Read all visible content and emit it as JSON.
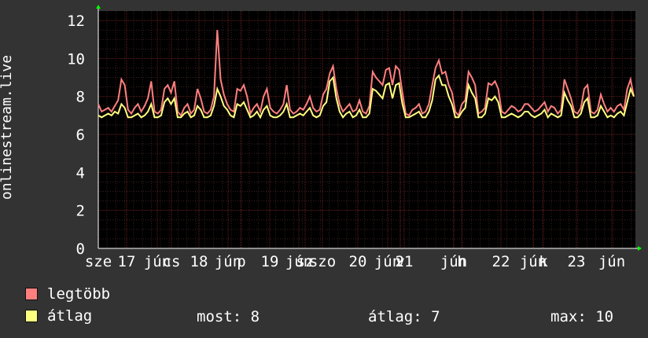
{
  "chart_data": {
    "type": "line",
    "ylabel": "onlinestream.live",
    "ylim": [
      0,
      12.5
    ],
    "yticks": [
      0,
      2,
      4,
      6,
      8,
      10,
      12
    ],
    "grid": true,
    "xtick_labels": [
      "sze",
      "17",
      "jún",
      "cs",
      "18",
      "jún",
      "p",
      "19",
      "jún",
      "sz",
      "szo",
      "20",
      "jún",
      "v",
      "21",
      "jún",
      "h",
      "22",
      "jún",
      "k",
      "23",
      "jún"
    ],
    "series": [
      {
        "name": "legtöbb",
        "color": "#ff7f7f",
        "values": [
          7.6,
          7.2,
          7.3,
          7.4,
          7.2,
          7.5,
          7.8,
          8.9,
          8.6,
          7.3,
          7.1,
          7.4,
          7.6,
          7.2,
          7.5,
          7.9,
          8.8,
          7.2,
          7.1,
          7.3,
          8.4,
          8.6,
          8.2,
          8.8,
          7.2,
          7.0,
          7.4,
          7.6,
          7.1,
          7.3,
          8.4,
          7.9,
          7.2,
          7.1,
          7.3,
          8.0,
          11.5,
          8.9,
          8.1,
          7.6,
          7.3,
          7.2,
          8.4,
          8.3,
          8.6,
          8.0,
          7.1,
          7.4,
          7.6,
          7.2,
          8.0,
          8.4,
          7.4,
          7.2,
          7.1,
          7.3,
          7.6,
          8.6,
          7.3,
          7.1,
          7.2,
          7.4,
          7.3,
          7.6,
          8.0,
          7.4,
          7.2,
          7.3,
          8.1,
          8.4,
          9.2,
          9.6,
          8.4,
          7.6,
          7.2,
          7.4,
          7.6,
          7.2,
          7.3,
          7.8,
          7.2,
          7.1,
          7.5,
          9.3,
          9.0,
          8.8,
          8.6,
          9.4,
          9.5,
          8.6,
          9.6,
          9.4,
          8.2,
          7.1,
          7.0,
          7.3,
          7.4,
          7.6,
          7.1,
          7.2,
          7.6,
          8.6,
          9.5,
          9.9,
          9.2,
          9.3,
          8.6,
          8.2,
          7.2,
          7.0,
          7.6,
          7.8,
          9.3,
          9.0,
          8.6,
          7.1,
          7.2,
          7.4,
          8.7,
          8.6,
          8.8,
          8.4,
          7.2,
          7.1,
          7.3,
          7.5,
          7.4,
          7.2,
          7.3,
          7.6,
          7.6,
          7.4,
          7.2,
          7.3,
          7.5,
          7.7,
          7.2,
          7.5,
          7.4,
          7.1,
          7.3,
          8.9,
          8.4,
          7.9,
          7.2,
          7.1,
          7.4,
          8.4,
          8.6,
          7.2,
          7.1,
          7.3,
          8.1,
          7.6,
          7.2,
          7.4,
          7.2,
          7.5,
          7.6,
          7.3,
          8.4,
          8.9,
          8.0
        ]
      },
      {
        "name": "átlag",
        "color": "#ffff7f",
        "values": [
          7.0,
          6.9,
          7.0,
          7.1,
          7.0,
          7.2,
          7.1,
          7.6,
          7.4,
          6.9,
          6.9,
          7.0,
          7.1,
          6.9,
          7.0,
          7.2,
          7.6,
          6.9,
          6.9,
          7.0,
          7.7,
          7.9,
          7.6,
          7.9,
          6.9,
          6.9,
          7.1,
          7.2,
          6.9,
          7.0,
          7.5,
          7.3,
          6.9,
          6.9,
          7.0,
          7.5,
          8.4,
          8.0,
          7.5,
          7.3,
          7.0,
          6.9,
          7.6,
          7.5,
          7.7,
          7.3,
          6.9,
          7.0,
          7.2,
          6.9,
          7.3,
          7.5,
          7.0,
          6.9,
          6.9,
          7.0,
          7.2,
          7.6,
          6.9,
          6.9,
          7.0,
          7.1,
          7.0,
          7.2,
          7.4,
          7.0,
          6.9,
          7.0,
          7.5,
          7.7,
          8.8,
          9.0,
          7.9,
          7.2,
          6.9,
          7.1,
          7.2,
          6.9,
          7.0,
          7.3,
          6.9,
          6.9,
          7.1,
          8.4,
          8.3,
          8.1,
          7.9,
          8.6,
          8.7,
          7.9,
          8.6,
          8.7,
          7.6,
          6.9,
          6.9,
          7.0,
          7.1,
          7.2,
          6.9,
          6.9,
          7.2,
          7.8,
          8.9,
          9.1,
          8.6,
          8.6,
          8.0,
          7.6,
          6.9,
          6.9,
          7.2,
          7.4,
          8.6,
          8.2,
          7.9,
          6.9,
          6.9,
          7.1,
          7.9,
          7.8,
          8.0,
          7.7,
          6.9,
          6.9,
          7.0,
          7.1,
          7.0,
          6.9,
          7.0,
          7.2,
          7.2,
          7.0,
          6.9,
          7.0,
          7.1,
          7.3,
          6.9,
          7.1,
          7.0,
          6.9,
          7.0,
          8.2,
          7.8,
          7.5,
          6.9,
          6.9,
          7.1,
          7.7,
          7.9,
          6.9,
          6.9,
          7.0,
          7.5,
          7.2,
          6.9,
          7.0,
          6.9,
          7.1,
          7.2,
          7.0,
          7.7,
          8.4,
          8.0
        ]
      }
    ]
  },
  "legend": {
    "items": [
      {
        "label": "legtöbb",
        "color": "#ff7f7f"
      },
      {
        "label": "átlag",
        "color": "#ffff7f"
      }
    ]
  },
  "stats": {
    "now": "most: 8",
    "avg": "átlag: 7",
    "max": "max: 10"
  }
}
